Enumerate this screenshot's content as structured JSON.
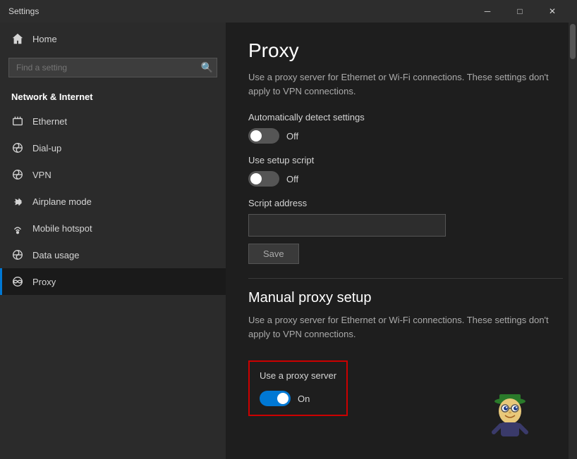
{
  "titleBar": {
    "title": "Settings",
    "minimizeLabel": "─",
    "maximizeLabel": "□",
    "closeLabel": "✕"
  },
  "sidebar": {
    "homeLabel": "Home",
    "searchPlaceholder": "Find a setting",
    "sectionLabel": "Network & Internet",
    "navItems": [
      {
        "id": "ethernet",
        "label": "Ethernet",
        "icon": "ethernet"
      },
      {
        "id": "dialup",
        "label": "Dial-up",
        "icon": "dialup"
      },
      {
        "id": "vpn",
        "label": "VPN",
        "icon": "vpn"
      },
      {
        "id": "airplane",
        "label": "Airplane mode",
        "icon": "airplane"
      },
      {
        "id": "hotspot",
        "label": "Mobile hotspot",
        "icon": "hotspot"
      },
      {
        "id": "datausage",
        "label": "Data usage",
        "icon": "data"
      },
      {
        "id": "proxy",
        "label": "Proxy",
        "icon": "proxy",
        "active": true
      }
    ]
  },
  "content": {
    "pageTitle": "Proxy",
    "autoDetectSection": {
      "description": "Use a proxy server for Ethernet or Wi-Fi connections. These settings don't apply to VPN connections.",
      "autoDetectLabel": "Automatically detect settings",
      "autoDetectState": "Off",
      "setupScriptLabel": "Use setup script",
      "setupScriptState": "Off",
      "scriptAddressLabel": "Script address",
      "scriptAddressValue": "",
      "saveLabel": "Save"
    },
    "manualSection": {
      "title": "Manual proxy setup",
      "description": "Use a proxy server for Ethernet or Wi-Fi connections. These settings don't apply to VPN connections.",
      "useProxyLabel": "Use a proxy server",
      "useProxyState": "On"
    }
  }
}
